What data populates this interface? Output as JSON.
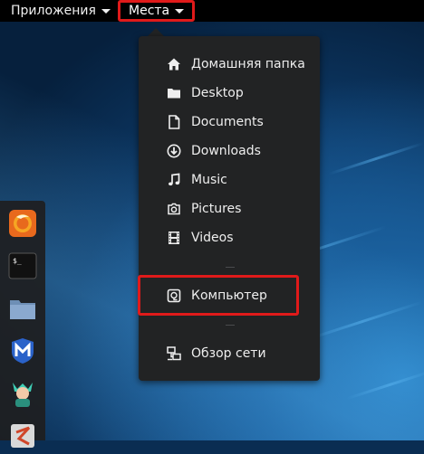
{
  "topbar": {
    "applications_label": "Приложения",
    "places_label": "Места"
  },
  "places_menu": {
    "items": [
      {
        "label": "Домашняя папка",
        "icon": "home-icon"
      },
      {
        "label": "Desktop",
        "icon": "folder-icon"
      },
      {
        "label": "Documents",
        "icon": "document-icon"
      },
      {
        "label": "Downloads",
        "icon": "download-icon"
      },
      {
        "label": "Music",
        "icon": "music-icon"
      },
      {
        "label": "Pictures",
        "icon": "camera-icon"
      },
      {
        "label": "Videos",
        "icon": "film-icon"
      },
      {
        "label": "Компьютер",
        "icon": "computer-icon"
      },
      {
        "label": "Обзор сети",
        "icon": "network-icon"
      }
    ]
  },
  "dock": {
    "items": [
      "firefox-icon",
      "terminal-icon",
      "files-icon",
      "metasploit-icon",
      "user-avatar-icon",
      "app-icon"
    ],
    "terminal_glyph": "$_"
  },
  "colors": {
    "highlight": "#e01a1a",
    "menu_bg": "#222324",
    "topbar_bg": "#000000"
  }
}
